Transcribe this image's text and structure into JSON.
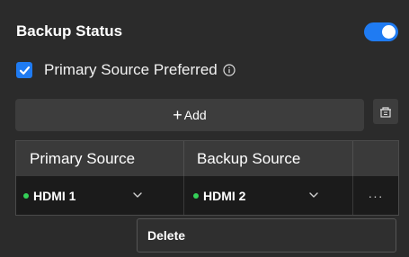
{
  "header": {
    "title": "Backup Status",
    "toggle_on": true
  },
  "option": {
    "label": "Primary Source Preferred",
    "checked": true,
    "info_icon": "info-circle-icon"
  },
  "toolbar": {
    "add_plus": "+",
    "add_label": "Add",
    "side_icon": "clipboard-icon"
  },
  "table": {
    "columns": [
      "Primary Source",
      "Backup Source",
      ""
    ],
    "rows": [
      {
        "primary": "HDMI 1",
        "primary_status_color": "#34d058",
        "backup": "HDMI 2",
        "backup_status_color": "#34d058",
        "actions": "···"
      }
    ]
  },
  "context_menu": {
    "items": [
      "Delete"
    ]
  },
  "colors": {
    "accent": "#1f7bf2",
    "status_ok": "#34d058",
    "background": "#2b2b2b"
  }
}
